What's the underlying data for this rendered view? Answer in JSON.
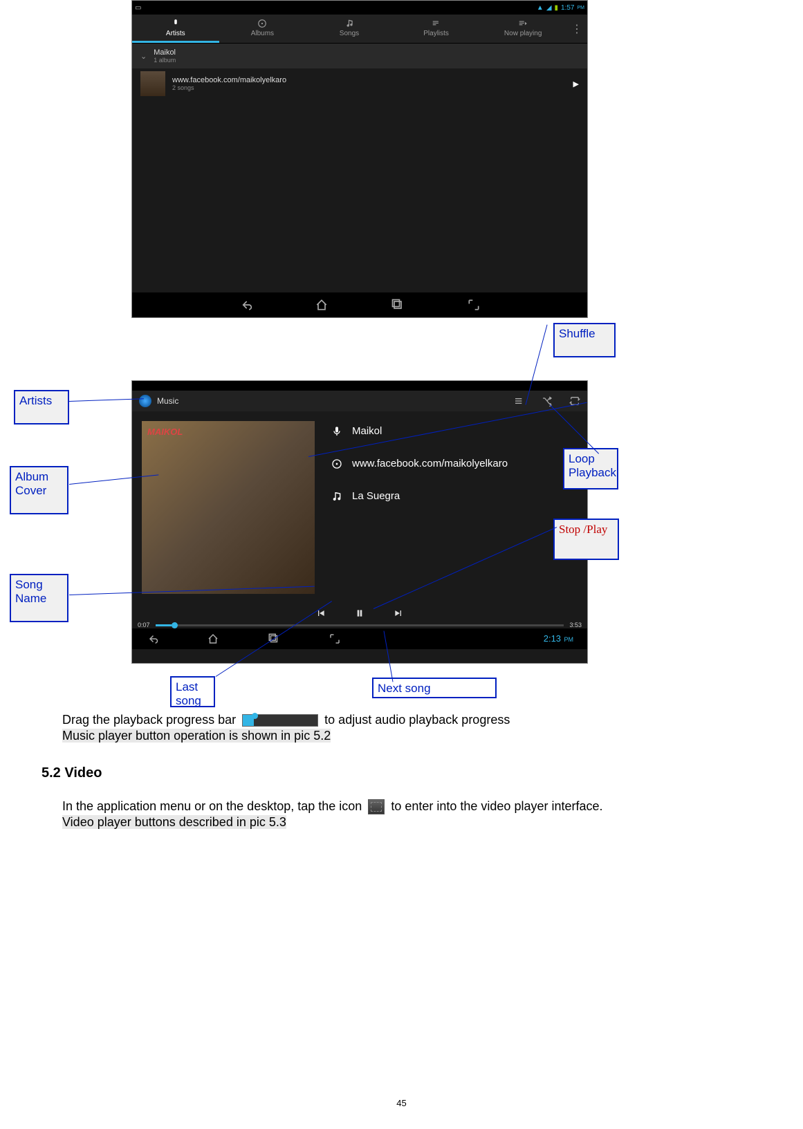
{
  "screenshot1": {
    "status_time": "1:57",
    "status_ampm": "PM",
    "tabs": [
      "Artists",
      "Albums",
      "Songs",
      "Playlists",
      "Now playing"
    ],
    "artist_name": "Maikol",
    "artist_sub": "1 album",
    "album_name": "www.facebook.com/maikolyelkaro",
    "album_sub": "2 songs"
  },
  "screenshot2": {
    "title": "Music",
    "artist": "Maikol",
    "album": "www.facebook.com/maikolyelkaro",
    "song": "La Suegra",
    "time_elapsed": "0:07",
    "time_total": "3:53",
    "clock": "2:13",
    "clock_ampm": "PM"
  },
  "annotations": {
    "shuffle": "Shuffle",
    "artists": "Artists",
    "album_cover": "Album Cover",
    "song_name": "Song Name",
    "loop": "Loop Playback",
    "stop_play": "Stop /Play",
    "last_song": "Last song",
    "next_song": "Next song"
  },
  "text": {
    "drag_pre": "Drag the playback progress bar",
    "drag_post": "to adjust audio playback progress",
    "music_ops": "Music player button operation is shown in pic 5.2",
    "section": "5.2 Video",
    "video_pre": "In the application menu or on the desktop, tap the icon",
    "video_post": "to enter into the video player interface.",
    "video_desc": "Video player buttons described in pic 5.3",
    "page": "45"
  }
}
